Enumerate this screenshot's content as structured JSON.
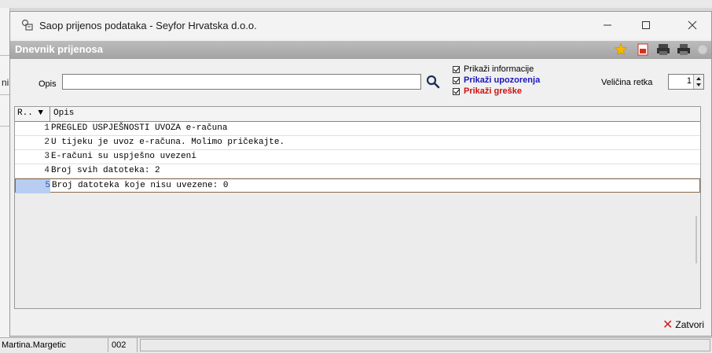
{
  "background": {
    "left_fragment_text": "ni"
  },
  "window": {
    "title": "Saop prijenos podataka - Seyfor Hrvatska d.o.o.",
    "header_title": "Dnevnik prijenosa"
  },
  "filter": {
    "opis_label": "Opis",
    "opis_value": "",
    "checkboxes": [
      {
        "label": "Prikaži informacije",
        "checked": true
      },
      {
        "label": "Prikaži upozorenja",
        "checked": true
      },
      {
        "label": "Prikaži greške",
        "checked": true
      }
    ],
    "velicina_label": "Veličina retka",
    "velicina_value": "1"
  },
  "grid": {
    "columns": [
      "R..",
      "Opis"
    ],
    "rows": [
      {
        "num": "1",
        "text": "PREGLED USPJEŠNOSTI UVOZA e-računa"
      },
      {
        "num": "2",
        "text": "U tijeku je uvoz e-računa. Molimo pričekajte."
      },
      {
        "num": "3",
        "text": "E-računi su uspješno uvezeni"
      },
      {
        "num": "4",
        "text": "Broj svih datoteka: 2"
      },
      {
        "num": "5",
        "text": "Broj datoteka koje nisu uvezene: 0"
      }
    ]
  },
  "footer": {
    "close_label": "Zatvori"
  },
  "statusbar": {
    "user": "Martina.Margetic",
    "code": "002"
  },
  "colors": {
    "header_bg": "#a9a9a9",
    "warning": "#1a18b8",
    "error": "#d01010",
    "selection": "#b9cdf2"
  }
}
